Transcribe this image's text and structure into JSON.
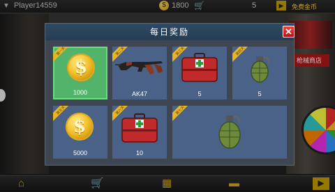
{
  "topbar": {
    "player_name": "Player14559",
    "coins": "1800",
    "count": "5",
    "free_gold": "免费金币"
  },
  "scene": {
    "shop_sign": "枪械商店"
  },
  "dialog": {
    "title": "每日奖励",
    "close_icon": "close-icon",
    "badge_text": "第一天",
    "rewards": [
      {
        "day_badge": "第一天",
        "item": "gold-coin",
        "label": "1000",
        "selected": true
      },
      {
        "day_badge": "第二天",
        "item": "ak47-rifle",
        "label": "AK47",
        "selected": false
      },
      {
        "day_badge": "第三天",
        "item": "medkit",
        "label": "5",
        "selected": false
      },
      {
        "day_badge": "第四天",
        "item": "grenade",
        "label": "5",
        "selected": false
      },
      {
        "day_badge": "第五天",
        "item": "gold-coin",
        "label": "5000",
        "selected": false
      },
      {
        "day_badge": "第六天",
        "item": "medkit",
        "label": "10",
        "selected": false
      },
      {
        "day_badge": "第七天",
        "item": "grenade",
        "label": "",
        "selected": false
      }
    ]
  },
  "colors": {
    "card_bg": "#4a6287",
    "selected_bg": "#52b36a",
    "title_bar": "#2e4a64",
    "close_button": "#d22b2b",
    "badge": "#e7b628"
  },
  "bottombar": {
    "icons": [
      "home-icon",
      "cart-icon",
      "map-icon",
      "car-icon",
      "play-icon"
    ]
  }
}
